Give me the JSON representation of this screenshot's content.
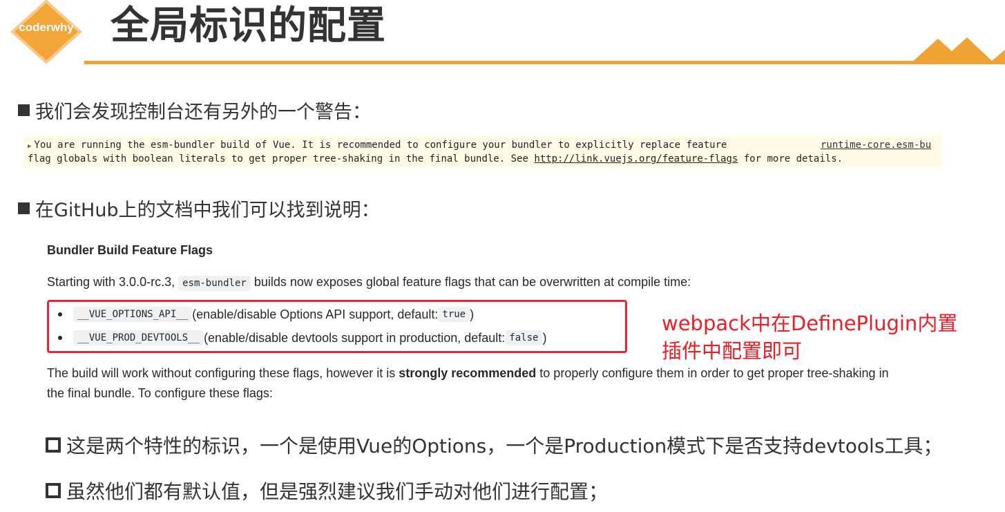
{
  "header": {
    "logo_text": "coderwhy",
    "title": "全局标识的配置",
    "accent_color": "#f0a234"
  },
  "bullet1": "我们会发现控制台还有另外的一个警告：",
  "console": {
    "line1": "You are running the esm-bundler build of Vue. It is recommended to configure your bundler to explicitly replace feature",
    "source": "runtime-core.esm-bu",
    "line2_prefix": "flag globals with boolean literals to get proper tree-shaking in the final bundle. See ",
    "link": "http://link.vuejs.org/feature-flags",
    "line2_suffix": " for more details."
  },
  "bullet2": "在GitHub上的文档中我们可以找到说明：",
  "doc": {
    "heading": "Bundler Build Feature Flags",
    "p1_before": "Starting with 3.0.0-rc.3, ",
    "p1_code": "esm-bundler",
    "p1_after": " builds now exposes global feature flags that can be overwritten at compile time:",
    "flags": [
      {
        "code": "__VUE_OPTIONS_API__",
        "text": " (enable/disable Options API support, default: ",
        "default": "true",
        "close": " )"
      },
      {
        "code": "__VUE_PROD_DEVTOOLS__",
        "text": " (enable/disable devtools support in production, default: ",
        "default": "false",
        "close": " )"
      }
    ],
    "p2_before": "The build will work without configuring these flags, however it is ",
    "p2_bold": "strongly recommended",
    "p2_after": " to properly configure them in order to get proper tree-shaking in the final bundle. To configure these flags:"
  },
  "annotation": {
    "line1": "webpack中在DefinePlugin内置",
    "line2": "插件中配置即可",
    "color": "#ee1c25"
  },
  "bullet3": "这是两个特性的标识，一个是使用Vue的Options，一个是Production模式下是否支持devtools工具；",
  "bullet4": "虽然他们都有默认值，但是强烈建议我们手动对他们进行配置；"
}
